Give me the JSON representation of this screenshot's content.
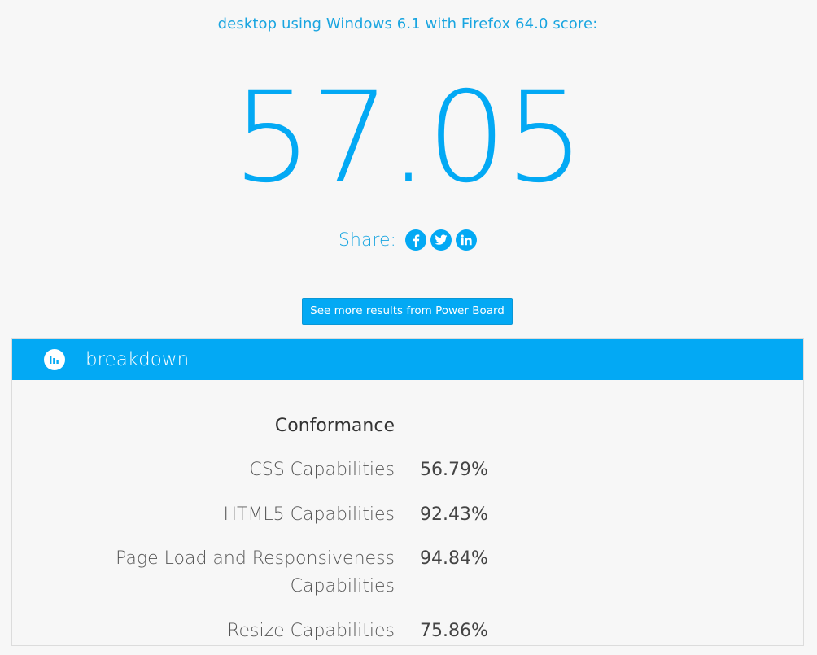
{
  "subtitle": "desktop using Windows 6.1 with Firefox 64.0 score:",
  "score": "57.05",
  "share": {
    "label": "Share:",
    "icons": [
      "facebook-icon",
      "twitter-icon",
      "linkedin-icon"
    ]
  },
  "more_button": "See more results from Power Board",
  "breakdown": {
    "title": "breakdown",
    "icon": "bar-chart-icon",
    "heading": "Conformance",
    "rows": [
      {
        "label": "CSS Capabilities",
        "value": "56.79%"
      },
      {
        "label": "HTML5 Capabilities",
        "value": "92.43%"
      },
      {
        "label_line1": "Page Load and Responsiveness",
        "label_line2": "Capabilities",
        "value": "94.84%"
      },
      {
        "label": "Resize Capabilities",
        "value": "75.86%"
      }
    ]
  },
  "colors": {
    "accent": "#03a9f4",
    "subtitle": "#19a5e0",
    "background": "#f7f7f7"
  }
}
